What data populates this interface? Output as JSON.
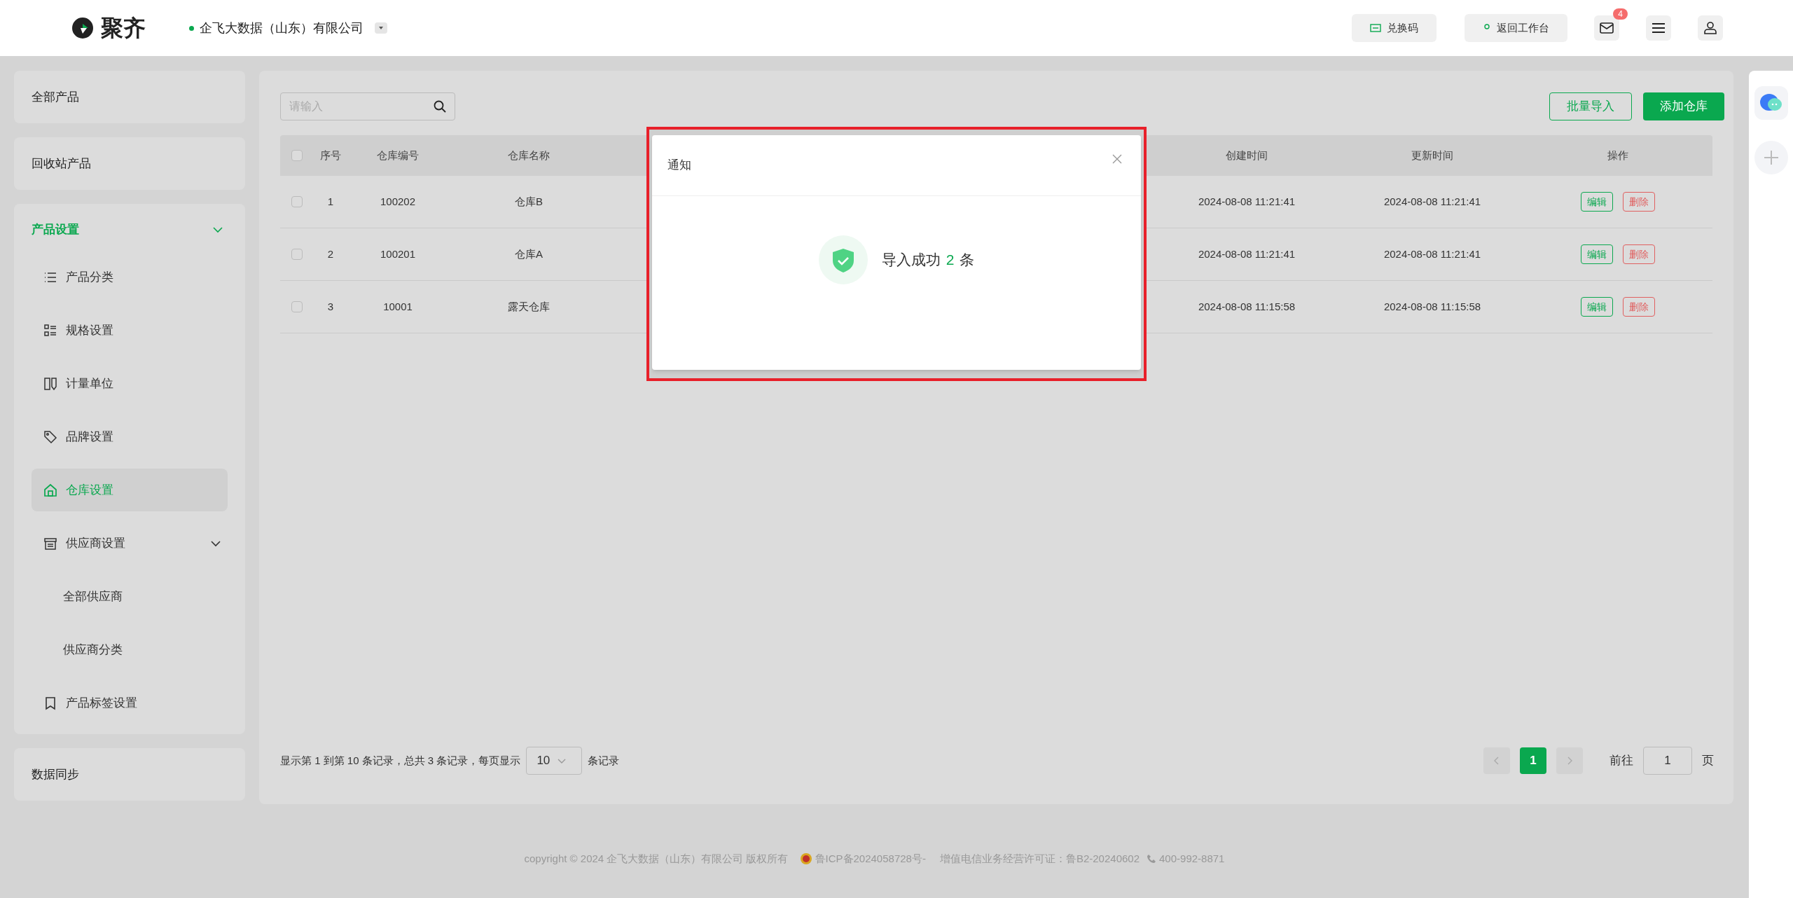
{
  "header": {
    "logo_text": "聚齐",
    "company": "企飞大数据（山东）有限公司",
    "buttons": [
      {
        "label": "兑换码"
      },
      {
        "label": "返回工作台"
      }
    ],
    "mail_badge": "4"
  },
  "sidebar": {
    "items": [
      {
        "label": "全部产品",
        "kind": "card"
      },
      {
        "label": "回收站产品",
        "kind": "card"
      },
      {
        "label": "产品设置",
        "kind": "group",
        "expanded": true,
        "children": [
          {
            "label": "产品分类",
            "selected": false
          },
          {
            "label": "规格设置",
            "selected": false
          },
          {
            "label": "计量单位",
            "selected": false
          },
          {
            "label": "品牌设置",
            "selected": false
          },
          {
            "label": "仓库设置",
            "selected": true
          },
          {
            "label": "供应商设置",
            "selected": false,
            "expanded": true,
            "children": [
              {
                "label": "全部供应商",
                "selected": false
              },
              {
                "label": "供应商分类",
                "selected": false
              }
            ]
          },
          {
            "label": "产品标签设置",
            "selected": false
          }
        ]
      },
      {
        "label": "数据同步",
        "kind": "card"
      }
    ]
  },
  "toolbar": {
    "search": {
      "placeholder": "请输入"
    },
    "buttons": [
      {
        "label": "批量导入",
        "kind": "outline"
      },
      {
        "label": "添加仓库",
        "kind": "primary"
      }
    ]
  },
  "table": {
    "header_checked": false,
    "columns": [
      "序号",
      "仓库编号",
      "仓库名称",
      "创建时间",
      "更新时间",
      "操作"
    ],
    "rows": [
      {
        "checked": false,
        "cells": [
          "1",
          "100202",
          "仓库B",
          "2024-08-08 11:21:41",
          "2024-08-08 11:21:41"
        ],
        "actions": [
          {
            "label": "编辑",
            "kind": "edit"
          },
          {
            "label": "删除",
            "kind": "delete"
          }
        ]
      },
      {
        "checked": false,
        "cells": [
          "2",
          "100201",
          "仓库A",
          "2024-08-08 11:21:41",
          "2024-08-08 11:21:41"
        ],
        "actions": [
          {
            "label": "编辑",
            "kind": "edit"
          },
          {
            "label": "删除",
            "kind": "delete"
          }
        ]
      },
      {
        "checked": false,
        "cells": [
          "3",
          "10001",
          "露天仓库",
          "2024-08-08 11:15:58",
          "2024-08-08 11:15:58"
        ],
        "actions": [
          {
            "label": "编辑",
            "kind": "edit"
          },
          {
            "label": "删除",
            "kind": "delete"
          }
        ]
      }
    ]
  },
  "pagination": {
    "summary": "显示第 1 到第 10 条记录，总共 3 条记录，每页显示",
    "page_size": "10",
    "page_size_suffix": "条记录",
    "pages": [
      {
        "label": "1",
        "selected": true
      }
    ],
    "goto_label": "前往",
    "goto_value": "1",
    "goto_suffix": "页"
  },
  "footer": {
    "copyright": "copyright © 2024 企飞大数据（山东）有限公司 版权所有",
    "icp": "鲁ICP备2024058728号-",
    "license": "增值电信业务经营许可证：鲁B2-20240602",
    "phone": "400-992-8871"
  },
  "modal": {
    "title": "通知",
    "message_prefix": "导入成功",
    "count": "2",
    "message_suffix": "条"
  }
}
